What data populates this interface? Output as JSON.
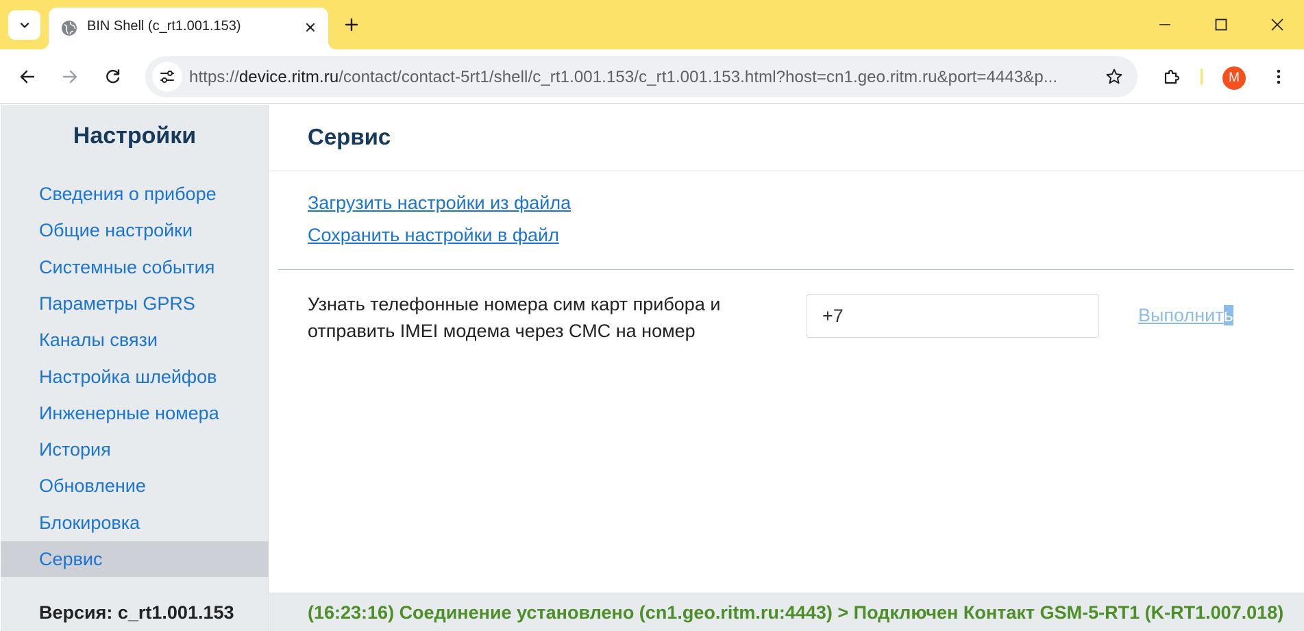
{
  "browser": {
    "tab_title": "BIN Shell (c_rt1.001.153)",
    "url_prefix": "https://",
    "url_host": "device.ritm.ru",
    "url_rest": "/contact/contact-5rt1/shell/c_rt1.001.153/c_rt1.001.153.html?host=cn1.geo.ritm.ru&port=4443&p...",
    "profile_initial": "M"
  },
  "sidebar": {
    "title": "Настройки",
    "items": [
      {
        "label": "Сведения о приборе"
      },
      {
        "label": "Общие настройки"
      },
      {
        "label": "Системные события"
      },
      {
        "label": "Параметры GPRS"
      },
      {
        "label": "Каналы связи"
      },
      {
        "label": "Настройка шлейфов"
      },
      {
        "label": "Инженерные номера"
      },
      {
        "label": "История"
      },
      {
        "label": "Обновление"
      },
      {
        "label": "Блокировка"
      },
      {
        "label": "Сервис"
      }
    ],
    "active_index": 10,
    "version": "Версия: c_rt1.001.153"
  },
  "main": {
    "title": "Сервис",
    "load_link": "Загрузить настройки из файла",
    "save_link": "Сохранить настройки в файл",
    "imei_label": "Узнать телефонные номера сим карт прибора и отправить IMEI модема через СМС на номер",
    "phone_value": "+7",
    "run_label_main": "Выполнит",
    "run_label_selected": "ь"
  },
  "status": {
    "text": "(16:23:16) Соединение установлено (cn1.geo.ritm.ru:4443) > Подключен Контакт GSM-5-RT1 (K-RT1.007.018)"
  },
  "colors": {
    "tabbar": "#fde26a",
    "link": "#1b74cf",
    "heading": "#163a5c",
    "status_ok": "#4c8f28",
    "avatar": "#f4511e"
  }
}
